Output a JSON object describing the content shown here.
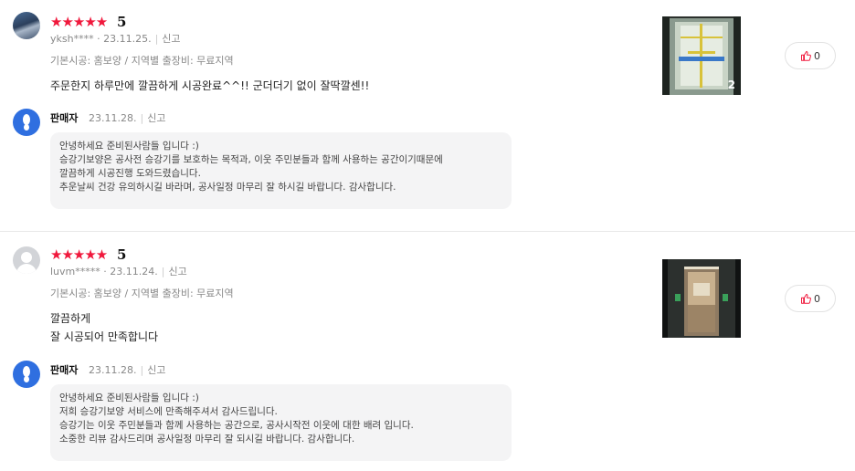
{
  "reviews": [
    {
      "stars": "★★★★★",
      "score": "5",
      "user": "yksh****",
      "date": "· 23.11.25.",
      "report": "신고",
      "option": "기본시공: 홈보양 / 지역별 출장비: 무료지역",
      "body": [
        "주문한지 하루만에 깔끔하게 시공완료^^!! 군더더기 없이  잘딱깔센!!"
      ],
      "photo_count": "2",
      "likes": "0",
      "seller": {
        "name": "판매자",
        "date": "23.11.28.",
        "report": "신고",
        "reply": [
          "안녕하세요 준비된사람들 입니다 :)",
          "승강기보양은 공사전 승강기를 보호하는 목적과, 이웃 주민분들과 함께 사용하는 공간이기때문에",
          "깔끔하게 시공진행 도와드렸습니다.",
          "추운날씨 건강 유의하시길 바라며, 공사일정 마무리 잘 하시길 바랍니다. 감사합니다."
        ]
      }
    },
    {
      "stars": "★★★★★",
      "score": "5",
      "user": "luvm*****",
      "date": "· 23.11.24.",
      "report": "신고",
      "option": "기본시공: 홈보양 / 지역별 출장비: 무료지역",
      "body": [
        "깔끔하게",
        "잘 시공되어 만족합니다"
      ],
      "likes": "0",
      "seller": {
        "name": "판매자",
        "date": "23.11.28.",
        "report": "신고",
        "reply": [
          "안녕하세요 준비된사람들 입니다 :)",
          "저희 승강기보양 서비스에 만족해주셔서 감사드립니다.",
          "승강기는 이웃 주민분들과 함께 사용하는 공간으로, 공사시작전 이웃에 대한 배려 입니다.",
          "소중한 리뷰 감사드리며 공사일정 마무리 잘 되시길 바랍니다. 감사합니다."
        ]
      }
    }
  ],
  "icons": {
    "like": "thumbs-up-icon",
    "seller": "seller-logo-icon"
  },
  "colors": {
    "star": "#f0183c",
    "seller_icon": "#2f6fe0",
    "reply_bg": "#f4f4f5"
  }
}
